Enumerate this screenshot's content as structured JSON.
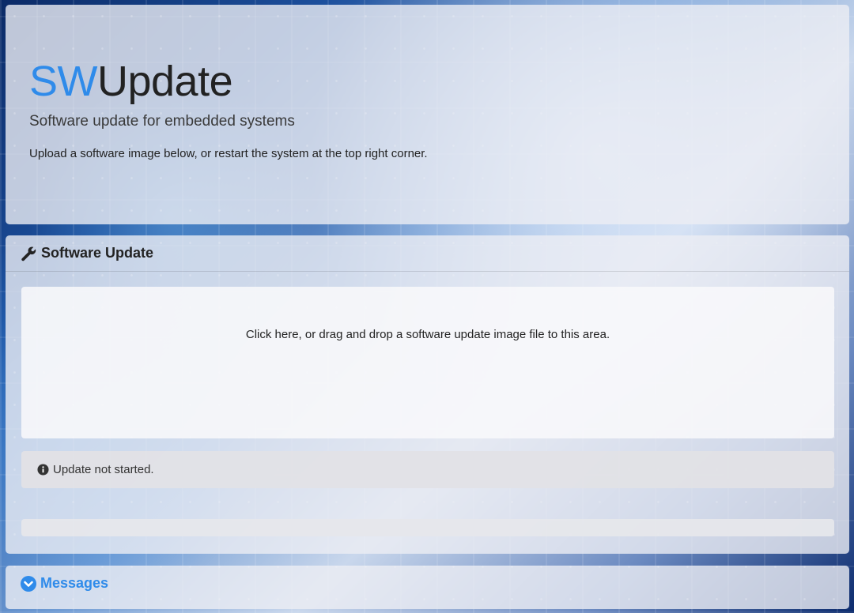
{
  "header": {
    "title_accent": "SW",
    "title_rest": "Update",
    "subtitle": "Software update for embedded systems",
    "lead": "Upload a software image below, or restart the system at the top right corner."
  },
  "update_card": {
    "title": "Software Update",
    "title_icon": "wrench-icon",
    "dropzone_message": "Click here, or drag and drop a software update image file to this area.",
    "status_icon": "info-circle-icon",
    "status_text": "Update not started.",
    "progress_percent": 0
  },
  "messages_card": {
    "label": "Messages",
    "icon": "chevron-down-circle-icon"
  },
  "colors": {
    "accent": "#2f8bea",
    "text": "#222222"
  }
}
